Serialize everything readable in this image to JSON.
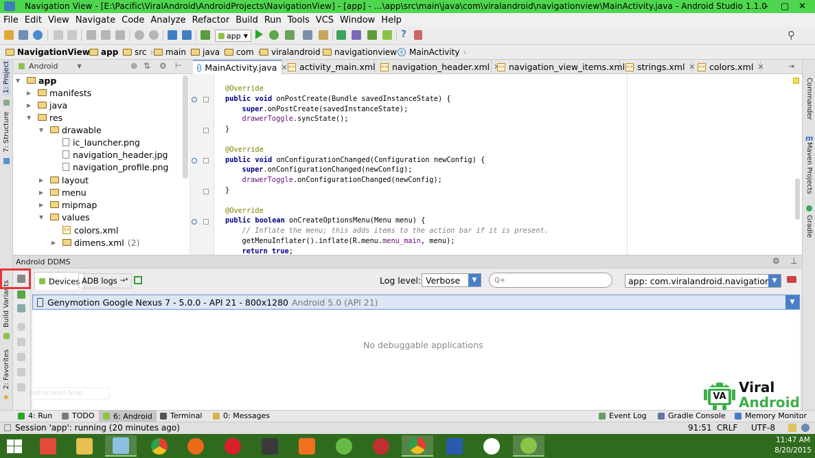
{
  "window": {
    "title": "Navigation View - [E:\\Pacific\\ViralAndroid\\AndroidProjects\\NavigationView] - [app] - ...\\app\\src\\main\\java\\com\\viralandroid\\navigationview\\MainActivity.java - Android Studio 1.1.0",
    "controls": [
      "–",
      "▢",
      "✕"
    ]
  },
  "menu": [
    "File",
    "Edit",
    "View",
    "Navigate",
    "Code",
    "Analyze",
    "Refactor",
    "Build",
    "Run",
    "Tools",
    "VCS",
    "Window",
    "Help"
  ],
  "toolbar": {
    "run_config": "app"
  },
  "breadcrumb": [
    "NavigationView",
    "app",
    "src",
    "main",
    "java",
    "com",
    "viralandroid",
    "navigationview",
    "MainActivity"
  ],
  "project_panel": {
    "view_mode": "Android",
    "tree": [
      {
        "label": "app",
        "bold": true
      },
      {
        "label": "manifests"
      },
      {
        "label": "java"
      },
      {
        "label": "res"
      },
      {
        "label": "drawable"
      },
      {
        "label": "ic_launcher.png"
      },
      {
        "label": "navigation_header.jpg"
      },
      {
        "label": "navigation_profile.png"
      },
      {
        "label": "layout"
      },
      {
        "label": "menu"
      },
      {
        "label": "mipmap"
      },
      {
        "label": "values"
      },
      {
        "label": "colors.xml"
      },
      {
        "label": "dimens.xml",
        "suffix": "(2)"
      }
    ]
  },
  "left_strip": {
    "project": "1: Project",
    "structure": "7: Structure",
    "build_variants": "Build Variants",
    "favorites": "2: Favorites"
  },
  "right_strip": {
    "commander": "Commander",
    "maven": "Maven Projects",
    "gradle": "Gradle"
  },
  "editor_tabs": [
    {
      "label": "MainActivity.java",
      "active": true,
      "kind": "java"
    },
    {
      "label": "activity_main.xml",
      "kind": "xml"
    },
    {
      "label": "navigation_header.xml",
      "kind": "xml"
    },
    {
      "label": "navigation_view_items.xml",
      "kind": "xml"
    },
    {
      "label": "strings.xml",
      "kind": "xml"
    },
    {
      "label": "colors.xml",
      "kind": "xml"
    }
  ],
  "code_lines": [
    {
      "indent": 0,
      "parts": [
        [
          "ann",
          "@Override"
        ]
      ]
    },
    {
      "indent": 0,
      "parts": [
        [
          "kw",
          "public void "
        ],
        [
          "",
          "onPostCreate(Bundle savedInstanceState) {"
        ]
      ]
    },
    {
      "indent": 1,
      "parts": [
        [
          "kw",
          "super"
        ],
        [
          "",
          ".onPostCreate(savedInstanceState);"
        ]
      ]
    },
    {
      "indent": 1,
      "parts": [
        [
          "fld",
          "drawerToggle"
        ],
        [
          "",
          ".syncState();"
        ]
      ]
    },
    {
      "indent": 0,
      "parts": [
        [
          "",
          "}"
        ]
      ]
    },
    {
      "indent": 0,
      "parts": [
        [
          "",
          ""
        ]
      ]
    },
    {
      "indent": 0,
      "parts": [
        [
          "ann",
          "@Override"
        ]
      ]
    },
    {
      "indent": 0,
      "parts": [
        [
          "kw",
          "public void "
        ],
        [
          "",
          "onConfigurationChanged(Configuration newConfig) {"
        ]
      ]
    },
    {
      "indent": 1,
      "parts": [
        [
          "kw",
          "super"
        ],
        [
          "",
          ".onConfigurationChanged(newConfig);"
        ]
      ]
    },
    {
      "indent": 1,
      "parts": [
        [
          "fld",
          "drawerToggle"
        ],
        [
          "",
          ".onConfigurationChanged(newConfig);"
        ]
      ]
    },
    {
      "indent": 0,
      "parts": [
        [
          "",
          "}"
        ]
      ]
    },
    {
      "indent": 0,
      "parts": [
        [
          "",
          ""
        ]
      ]
    },
    {
      "indent": 0,
      "parts": [
        [
          "ann",
          "@Override"
        ]
      ]
    },
    {
      "indent": 0,
      "parts": [
        [
          "kw",
          "public boolean "
        ],
        [
          "",
          "onCreateOptionsMenu(Menu menu) {"
        ]
      ]
    },
    {
      "indent": 1,
      "parts": [
        [
          "cmt",
          "// Inflate the menu; this adds items to the action bar if it is present."
        ]
      ]
    },
    {
      "indent": 1,
      "parts": [
        [
          "",
          "getMenuInflater().inflate(R.menu."
        ],
        [
          "fld",
          "menu_main"
        ],
        [
          "",
          ", menu);"
        ]
      ]
    },
    {
      "indent": 1,
      "parts": [
        [
          "kw",
          "return true"
        ],
        [
          "",
          ";"
        ]
      ]
    }
  ],
  "ddms": {
    "title": "Android DDMS",
    "tabs": [
      "Devices",
      "ADB logs"
    ],
    "log_level_label": "Log level:",
    "log_level": "Verbose",
    "search_placeholder": "Q+",
    "app_filter": "app: com.viralandroid.navigationview",
    "device": "Genymotion Google Nexus 7 - 5.0.0 - API 21 - 800x1280",
    "device_os": "Android 5.0 (API 21)",
    "empty_message": "No debuggable applications",
    "snip_tooltip": "Full-screen Snip"
  },
  "bottom_tools": [
    {
      "label": "4: Run",
      "num": "4"
    },
    {
      "label": "TODO"
    },
    {
      "label": "6: Android",
      "num": "6",
      "active": true
    },
    {
      "label": "Terminal"
    },
    {
      "label": "0: Messages",
      "num": "0"
    }
  ],
  "bottom_right_tools": [
    "Event Log",
    "Gradle Console",
    "Memory Monitor"
  ],
  "status": {
    "message": "Session 'app': running (20 minutes ago)",
    "position": "91:51",
    "line_sep": "CRLF",
    "encoding": "UTF-8"
  },
  "logo": {
    "line1": "Viral",
    "line2": "Android",
    "mark": "VA"
  },
  "taskbar": {
    "time": "11:47 AM",
    "date": "8/20/2015",
    "apps": [
      "start",
      "metro",
      "explorer",
      "snipping",
      "chrome",
      "firefox",
      "opera",
      "sublime",
      "xampp",
      "utorrent",
      "media",
      "chrome-2",
      "word",
      "flickr",
      "android-studio"
    ]
  },
  "colors": {
    "title_bar": "#4fd64f",
    "taskbar": "#2f6a1e",
    "highlight": "#e8333a",
    "brand_green": "#3dae49"
  }
}
